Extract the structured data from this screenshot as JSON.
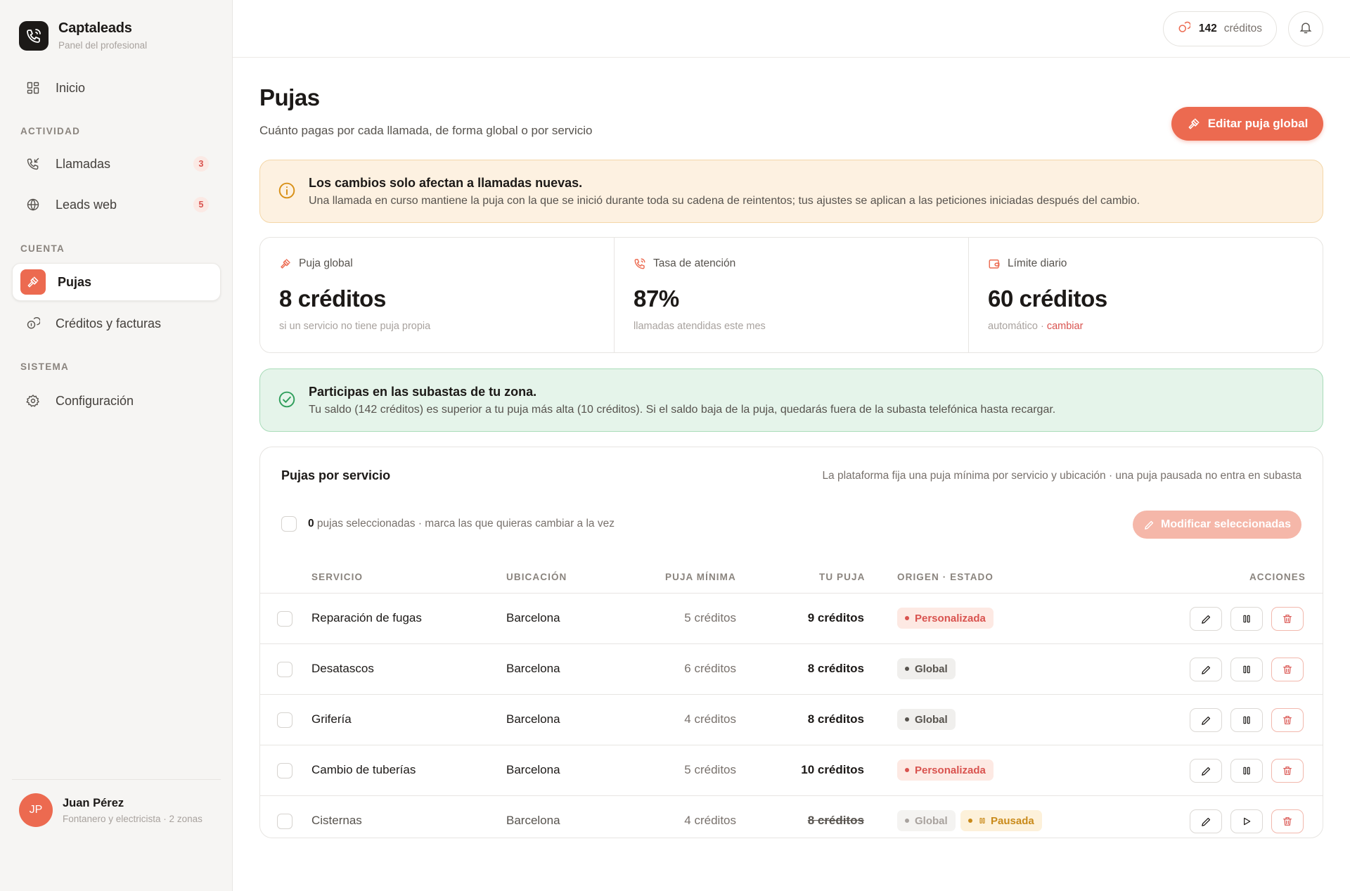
{
  "brand": {
    "name": "Captaleads",
    "subtitle": "Panel del profesional"
  },
  "nav": {
    "home": "Inicio",
    "section_activity": "ACTIVIDAD",
    "calls": {
      "label": "Llamadas",
      "badge": "3"
    },
    "web_leads": {
      "label": "Leads web",
      "badge": "5"
    },
    "section_account": "CUENTA",
    "bids": "Pujas",
    "credits_invoices": "Créditos y facturas",
    "section_system": "SISTEMA",
    "settings": "Configuración"
  },
  "user": {
    "initials": "JP",
    "name": "Juan Pérez",
    "role": "Fontanero y electricista · 2 zonas"
  },
  "topbar": {
    "credits_value": "142",
    "credits_label": "créditos"
  },
  "header": {
    "title": "Pujas",
    "subtitle": "Cuánto pagas por cada llamada, de forma global o por servicio",
    "edit_global_label": "Editar puja global"
  },
  "warning": {
    "title": "Los cambios solo afectan a llamadas nuevas.",
    "body": "Una llamada en curso mantiene la puja con la que se inició durante toda su cadena de reintentos; tus ajustes se aplican a las peticiones iniciadas después del cambio."
  },
  "stats": [
    {
      "label": "Puja global",
      "value": "8 créditos",
      "foot": "si un servicio no tiene puja propia"
    },
    {
      "label": "Tasa de atención",
      "value": "87%",
      "foot": "llamadas atendidas este mes"
    },
    {
      "label": "Límite diario",
      "value": "60 créditos",
      "foot": "automático · ",
      "foot_link": "cambiar"
    }
  ],
  "success": {
    "title": "Participas en las subastas de tu zona.",
    "body": "Tu saldo (142 créditos) es superior a tu puja más alta (10 créditos). Si el saldo baja de la puja, quedarás fuera de la subasta telefónica hasta recargar."
  },
  "table": {
    "title": "Pujas por servicio",
    "note": "La plataforma fija una puja mínima por servicio y ubicación · una puja pausada no entra en subasta",
    "selected_count": "0",
    "selected_text": " pujas seleccionadas · marca las que quieras cambiar a la vez",
    "modify_selected_label": "Modificar seleccionadas",
    "columns": {
      "service": "SERVICIO",
      "location": "UBICACIÓN",
      "min_bid": "PUJA MÍNIMA",
      "your_bid": "TU PUJA",
      "origin_status": "ORIGEN · ESTADO",
      "actions": "ACCIONES"
    },
    "rows": [
      {
        "service": "Reparación de fugas",
        "location": "Barcelona",
        "min_bid": "5 créditos",
        "your_bid": "9 créditos",
        "origin": "Personalizada",
        "status": ""
      },
      {
        "service": "Desatascos",
        "location": "Barcelona",
        "min_bid": "6 créditos",
        "your_bid": "8 créditos",
        "origin": "Global",
        "status": ""
      },
      {
        "service": "Grifería",
        "location": "Barcelona",
        "min_bid": "4 créditos",
        "your_bid": "8 créditos",
        "origin": "Global",
        "status": ""
      },
      {
        "service": "Cambio de tuberías",
        "location": "Barcelona",
        "min_bid": "5 créditos",
        "your_bid": "10 créditos",
        "origin": "Personalizada",
        "status": ""
      },
      {
        "service": "Cisternas",
        "location": "Barcelona",
        "min_bid": "4 créditos",
        "your_bid": "8 créditos",
        "origin": "Global",
        "status": "Pausada"
      }
    ]
  },
  "colors": {
    "accent": "#ec6a50",
    "danger": "#d9534f",
    "warning_bg": "#fdf1e1",
    "success_bg": "#e5f4ea",
    "success_icon": "#2f9e5b",
    "warning_icon": "#d89016"
  },
  "icons": [
    "phone-logo-icon",
    "grid-icon",
    "phone-incoming-icon",
    "globe-icon",
    "gavel-icon",
    "coins-icon",
    "gear-icon",
    "bell-icon",
    "info-icon",
    "check-circle-icon",
    "phone-icon",
    "wallet-icon",
    "pencil-icon",
    "pause-icon",
    "play-icon",
    "trash-icon"
  ]
}
